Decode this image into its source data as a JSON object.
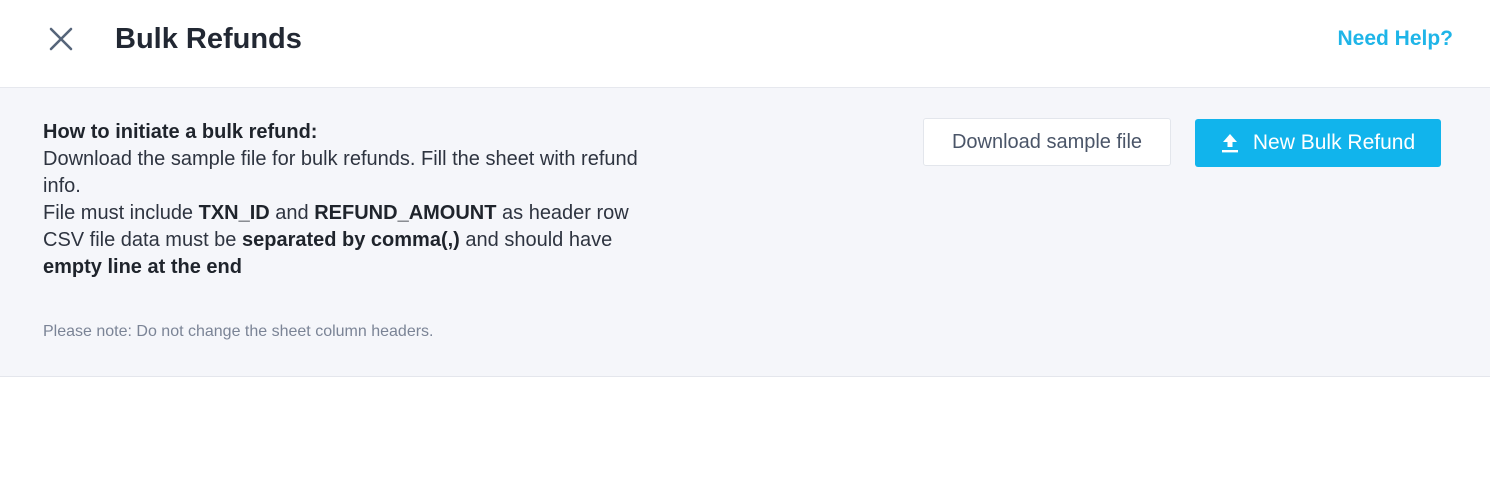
{
  "header": {
    "close_icon": "close-icon",
    "title": "Bulk Refunds",
    "help_link": "Need Help?"
  },
  "panel": {
    "heading": "How to initiate a bulk refund:",
    "line1": "Download the sample file for bulk refunds. Fill the sheet with refund info.",
    "line2_pre": "File must include ",
    "line2_b1": "TXN_ID",
    "line2_mid": " and ",
    "line2_b2": "REFUND_AMOUNT",
    "line2_post": " as header row",
    "line3_pre": "CSV file data must be ",
    "line3_b1": "separated by comma(,)",
    "line3_mid": " and should have ",
    "line3_b2": "empty line at the end",
    "note": "Please note: Do not change the sheet column headers.",
    "download_button": "Download sample file",
    "new_refund_button": "New Bulk Refund",
    "upload_icon": "upload-icon"
  },
  "colors": {
    "accent": "#11b4ec",
    "link": "#1fb5e8",
    "panel_bg": "#f5f6fa"
  }
}
